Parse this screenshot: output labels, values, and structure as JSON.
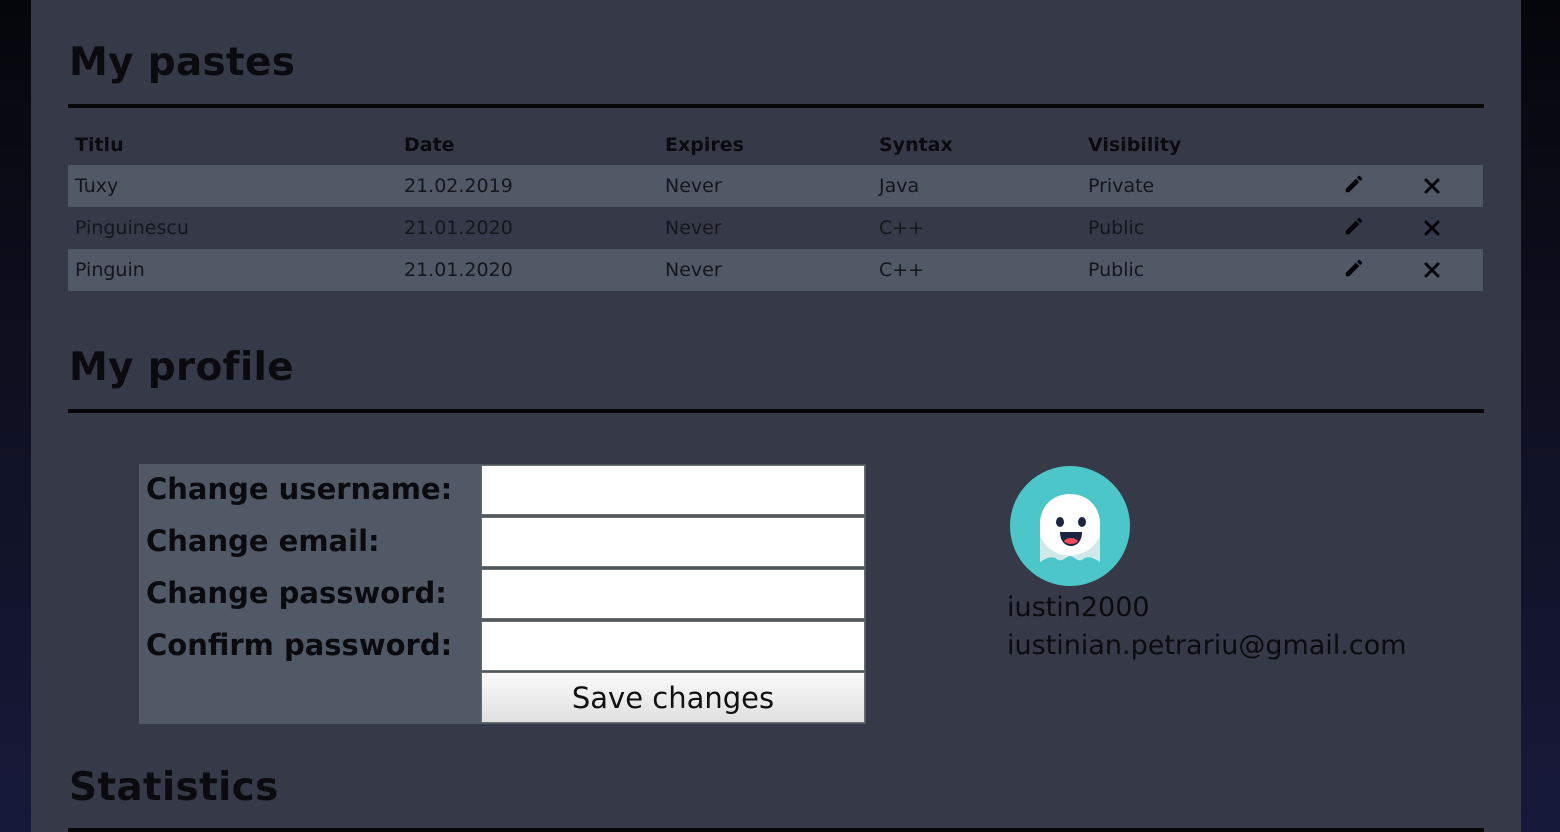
{
  "pastes": {
    "title": "My pastes",
    "columns": [
      "Titlu",
      "Date",
      "Expires",
      "Syntax",
      "Visibility"
    ],
    "rows": [
      {
        "title": "Tuxy",
        "date": "21.02.2019",
        "expires": "Never",
        "syntax": "Java",
        "visibility": "Private"
      },
      {
        "title": "Pinguinescu",
        "date": "21.01.2020",
        "expires": "Never",
        "syntax": "C++",
        "visibility": "Public"
      },
      {
        "title": "Pinguin",
        "date": "21.01.2020",
        "expires": "Never",
        "syntax": "C++",
        "visibility": "Public"
      }
    ],
    "row_icons": [
      "pencil-icon",
      "close-icon"
    ]
  },
  "profile": {
    "title": "My profile",
    "form": {
      "username_label": "Change username:",
      "email_label": "Change email:",
      "password_label": "Change password:",
      "confirm_label": "Confirm password:",
      "username_value": "",
      "email_value": "",
      "password_value": "",
      "confirm_value": "",
      "save_label": "Save changes"
    },
    "avatar_icon": "ghost-avatar-icon",
    "username": "iustin2000",
    "email": "iustinian.petrariu@gmail.com"
  },
  "statistics": {
    "title": "Statistics"
  },
  "colors": {
    "panel": "#363a48",
    "row_highlight": "#515866",
    "avatar_bg": "#4cc6c8",
    "text": "#0b0b0f"
  }
}
